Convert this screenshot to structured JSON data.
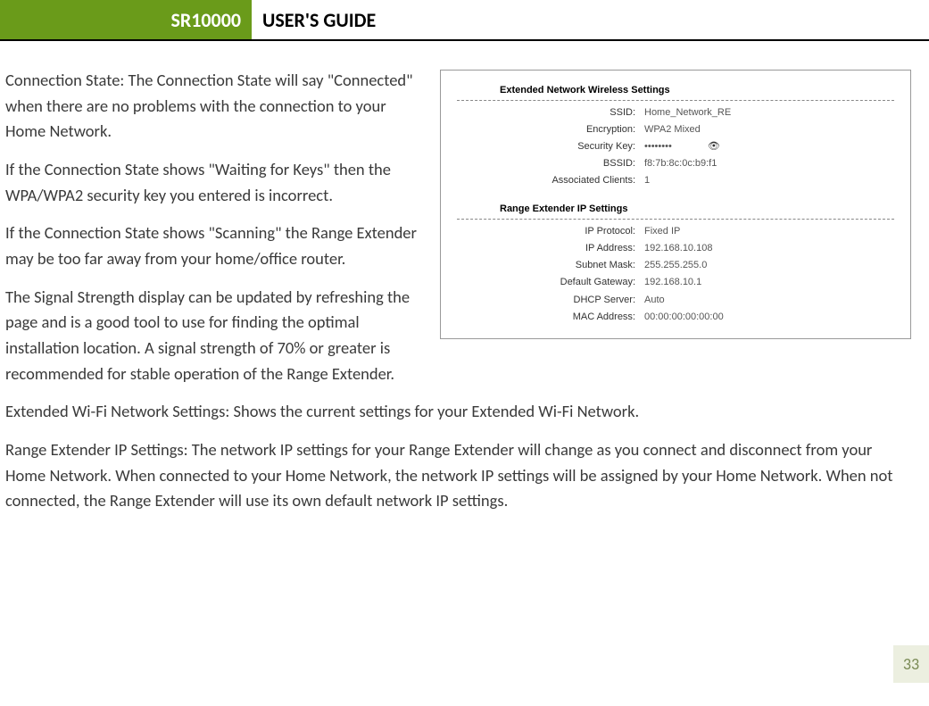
{
  "header": {
    "model": "SR10000",
    "title": "USER'S GUIDE"
  },
  "body": {
    "p1": "Connection State: The Connection State will say \"Connected\" when there are no problems with the connection to your Home Network.",
    "p2": "If the Connection State shows \"Waiting for Keys\" then the WPA/WPA2 security key you entered is incorrect.",
    "p3": "If the Connection State shows \"Scanning\" the Range Extender may be too far away from your home/office router.",
    "p4": "The Signal Strength display can be updated by refreshing the page and is a good tool to use for finding the optimal installation location. A signal strength of 70% or greater is recommended for stable operation of the Range Extender.",
    "p5": "Extended Wi-Fi Network Settings: Shows the current settings for your Extended Wi-Fi Network.",
    "p6": "Range Extender IP Settings:  The network IP settings for your Range Extender will change as you connect and disconnect from your Home Network. When connected to your Home Network, the network IP settings will be assigned by your Home Network. When not connected, the Range Extender will use its own default network IP settings."
  },
  "figure": {
    "section1_title": "Extended Network Wireless Settings",
    "ssid_label": "SSID:",
    "ssid_value": "Home_Network_RE",
    "enc_label": "Encryption:",
    "enc_value": "WPA2 Mixed",
    "key_label": "Security Key:",
    "key_value": "••••••••",
    "bssid_label": "BSSID:",
    "bssid_value": "f8:7b:8c:0c:b9:f1",
    "clients_label": "Associated Clients:",
    "clients_value": "1",
    "section2_title": "Range Extender IP Settings",
    "proto_label": "IP Protocol:",
    "proto_value": "Fixed IP",
    "ip_label": "IP Address:",
    "ip_value": "192.168.10.108",
    "mask_label": "Subnet Mask:",
    "mask_value": "255.255.255.0",
    "gw_label": "Default Gateway:",
    "gw_value": "192.168.10.1",
    "dhcp_label": "DHCP Server:",
    "dhcp_value": "Auto",
    "mac_label": "MAC Address:",
    "mac_value": "00:00:00:00:00:00"
  },
  "page_number": "33"
}
